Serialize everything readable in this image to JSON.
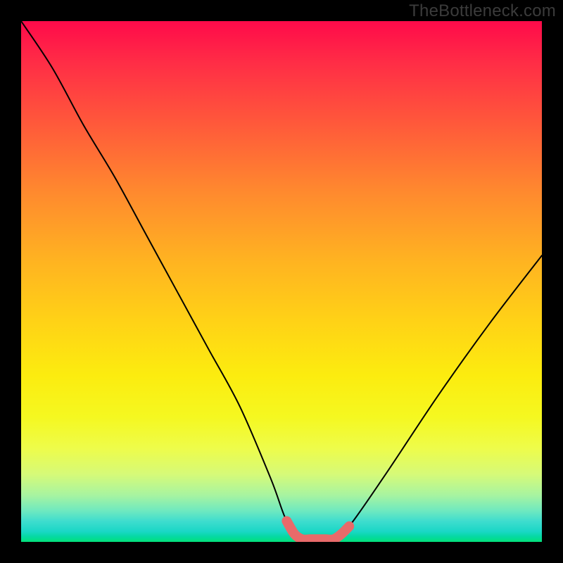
{
  "watermark": "TheBottleneck.com",
  "chart_data": {
    "type": "line",
    "title": "",
    "xlabel": "",
    "ylabel": "",
    "xlim": [
      0,
      100
    ],
    "ylim": [
      0,
      100
    ],
    "series": [
      {
        "name": "bottleneck-curve",
        "x": [
          0,
          6,
          12,
          18,
          24,
          30,
          36,
          42,
          48,
          51,
          54,
          57,
          60,
          63,
          70,
          80,
          90,
          100
        ],
        "y": [
          100,
          91,
          80,
          70,
          59,
          48,
          37,
          26,
          12,
          4,
          0.5,
          0.5,
          0.5,
          3,
          13,
          28,
          42,
          55
        ]
      },
      {
        "name": "flat-minimum",
        "x": [
          51,
          52.5,
          54,
          55.5,
          57,
          58.5,
          60,
          61.5,
          63
        ],
        "y": [
          4,
          1.5,
          0.5,
          0.5,
          0.5,
          0.5,
          0.5,
          1.5,
          3
        ]
      }
    ],
    "colors": {
      "curve": "#000000",
      "minimum": "#e86a6a",
      "gradient_top": "#ff0a4a",
      "gradient_bottom": "#03e07a"
    }
  }
}
